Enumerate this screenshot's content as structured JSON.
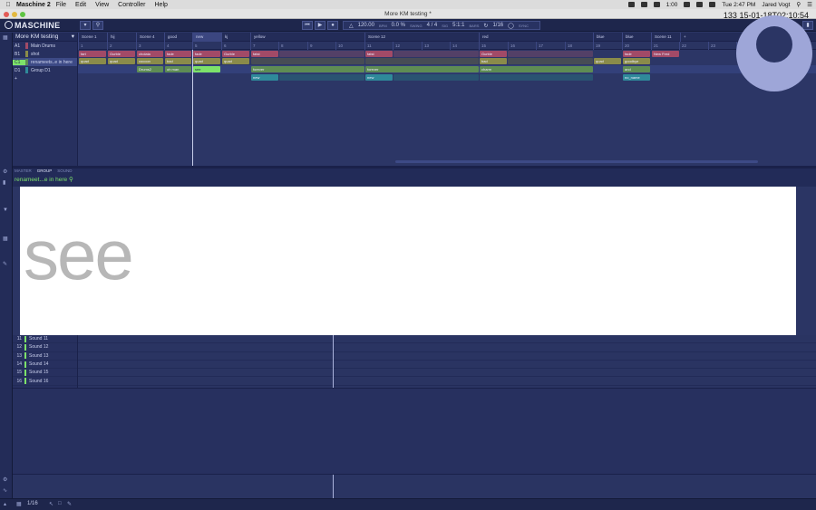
{
  "menubar": {
    "app_name": "Maschine 2",
    "items": [
      "File",
      "Edit",
      "View",
      "Controller",
      "Help"
    ],
    "battery": "1:00",
    "clock": "Tue 2:47 PM",
    "user": "Jared Vogt"
  },
  "window": {
    "title": "More KM testing *",
    "timestamp_overlay": "133 15-01-18T02:10:54"
  },
  "header": {
    "logo": "MASCHINE",
    "tempo": "120.00",
    "tempo_label": "BPM",
    "swing": "0.0 %",
    "swing_label": "SWING",
    "signature": "4 / 4",
    "signature_label": "SIG",
    "position": "5:1:1",
    "position_label": "BARS",
    "grid": "1/16",
    "sync_label": "SYNC"
  },
  "project": {
    "title": "More KM testing",
    "groups": [
      {
        "id": "A1",
        "name": "Main Drums"
      },
      {
        "id": "B1",
        "name": "shot"
      },
      {
        "id": "C1",
        "name": "renameets..e in here"
      },
      {
        "id": "D1",
        "name": "Group D1"
      }
    ],
    "add_label": "+"
  },
  "arranger": {
    "scenes": [
      {
        "label": "Scene 1"
      },
      {
        "label": "hij"
      },
      {
        "label": "Scene 4"
      },
      {
        "label": "good"
      },
      {
        "label": "new"
      },
      {
        "label": "kj"
      },
      {
        "label": "yellow"
      },
      {
        "label": "Scene 12"
      },
      {
        "label": "red"
      },
      {
        "label": "blue"
      },
      {
        "label": "blue"
      },
      {
        "label": "Scene 11"
      },
      {
        "label": "+"
      }
    ],
    "bars": [
      "1",
      "2",
      "3",
      "4",
      "5",
      "6",
      "7",
      "8",
      "9",
      "10",
      "11",
      "12",
      "13",
      "14",
      "15",
      "16",
      "17",
      "18",
      "19",
      "20",
      "21",
      "22",
      "23",
      "24",
      "25"
    ],
    "clips_row_a": [
      {
        "label": "fart"
      },
      {
        "label": "Gurble"
      },
      {
        "label": "cholata"
      },
      {
        "label": "fade"
      },
      {
        "label": "fade"
      },
      {
        "label": "Gurble"
      },
      {
        "label": "fatst"
      },
      {
        "label": "fatst"
      },
      {
        "label": "Gurble"
      },
      {
        "label": "fade"
      },
      {
        "label": "New Fred"
      }
    ],
    "clips_row_b": [
      {
        "label": "quad"
      },
      {
        "label": "quad"
      },
      {
        "label": "cocoon"
      },
      {
        "label": "bad"
      },
      {
        "label": "quad"
      },
      {
        "label": "quad"
      },
      {
        "label": "bad"
      },
      {
        "label": "quad"
      },
      {
        "label": "goodbye"
      }
    ],
    "clips_row_c": [
      {
        "label": "Drums2"
      },
      {
        "label": "oh man"
      },
      {
        "label": "see"
      },
      {
        "label": "forever"
      },
      {
        "label": "forever"
      },
      {
        "label": "charm"
      },
      {
        "label": "and"
      }
    ],
    "clips_row_d": [
      {
        "label": "new"
      },
      {
        "label": "new"
      },
      {
        "label": "no_name"
      }
    ]
  },
  "group_panel": {
    "tabs": [
      "MASTER",
      "GROUP",
      "SOUND"
    ],
    "active_tab": "GROUP",
    "group_name": "renameet...e in here"
  },
  "overlay": {
    "word": "see"
  },
  "sounds": [
    {
      "num": "11",
      "name": "Sound 11"
    },
    {
      "num": "12",
      "name": "Sound 12"
    },
    {
      "num": "13",
      "name": "Sound 13"
    },
    {
      "num": "14",
      "name": "Sound 14"
    },
    {
      "num": "15",
      "name": "Sound 15"
    },
    {
      "num": "16",
      "name": "Sound 16"
    }
  ],
  "footer": {
    "step": "1/16"
  },
  "colors": {
    "red_clip": "#a24a67",
    "olive_clip": "#8a8b4a",
    "green_clip": "#5e8c54",
    "bright_green_clip": "#7de26a",
    "teal_clip": "#2f8a9a",
    "accent_green": "#7de26a"
  }
}
